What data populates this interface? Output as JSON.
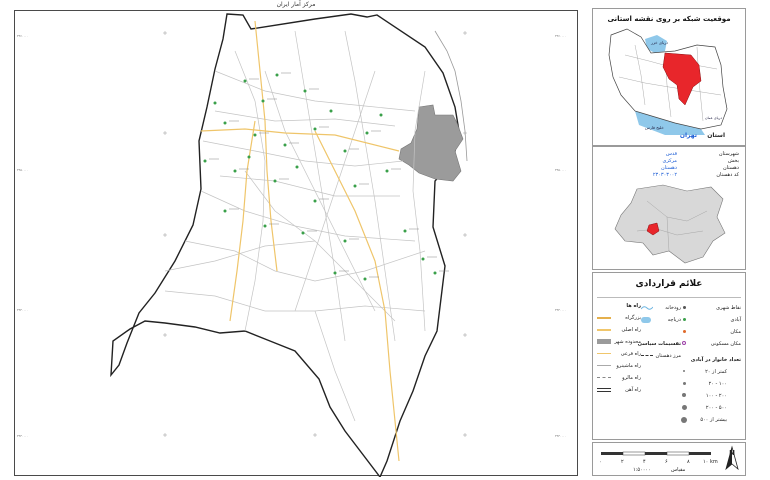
{
  "header": {
    "source": "مرکز آمار ایران"
  },
  "location": {
    "title": "موقعیت شبکه بر روی نقشه استانی",
    "province_label": "استان",
    "province_name": "تهران",
    "sea_north": "دریای خزر",
    "sea_south": "خلیج فارس",
    "sea_oman": "دریای عمان",
    "highlight_color": "#e8262b",
    "water_color": "#8fc8ea"
  },
  "admin_info": {
    "rows": [
      {
        "label": "شهرستان",
        "value": "قدس"
      },
      {
        "label": "بخش",
        "value": "مرکزی"
      },
      {
        "label": "دهستان",
        "value": "دهستان"
      },
      {
        "label": "کد دهستان",
        "value": "۲۳۰۳۰۳۰۰۲"
      }
    ]
  },
  "legend": {
    "title": "علائم قراردادی",
    "roads_title": "راه ها",
    "roads": [
      "بزرگراه",
      "راه اصلی",
      "محدوده شهر",
      "راه فرعی",
      "راه ماشینرو",
      "راه مالرو",
      "راه آهن"
    ],
    "point_items": [
      "نقاط شهری",
      "آبادی",
      "مکان",
      "مکان مسکونی"
    ],
    "area_items": [
      "رودخانه",
      "دریاچه"
    ],
    "divisions_title": "تقسیمات سیاسی",
    "divisions": [
      "مرز دهستان"
    ],
    "pop_title": "تعداد خانوار در آبادی",
    "pop_classes": [
      "کمتر از ۲۰",
      "۲۰ - ۱۰۰",
      "۱۰۰ - ۲۰۰",
      "۲۰۰ - ۵۰۰",
      "بیشتر از ۵۰۰"
    ]
  },
  "scale": {
    "label": "مقیاس",
    "value": "۱:۵۰۰۰۰",
    "units": [
      "۰",
      "۲",
      "۴",
      "۶",
      "۸",
      "۱۰ km"
    ]
  },
  "north": {
    "label": "N"
  },
  "map": {
    "outline_color": "#222222",
    "city_color": "#9b9b9b",
    "road_color": "#c7c7c7",
    "main_road_color": "#f0c66b",
    "village_color": "#3aa04a",
    "grid_labels": [
      "۳۹۶۰۰۰۰",
      "۳۹۵۰۰۰۰",
      "۳۹۴۰۰۰۰",
      "۳۹۳۰۰۰۰"
    ]
  }
}
